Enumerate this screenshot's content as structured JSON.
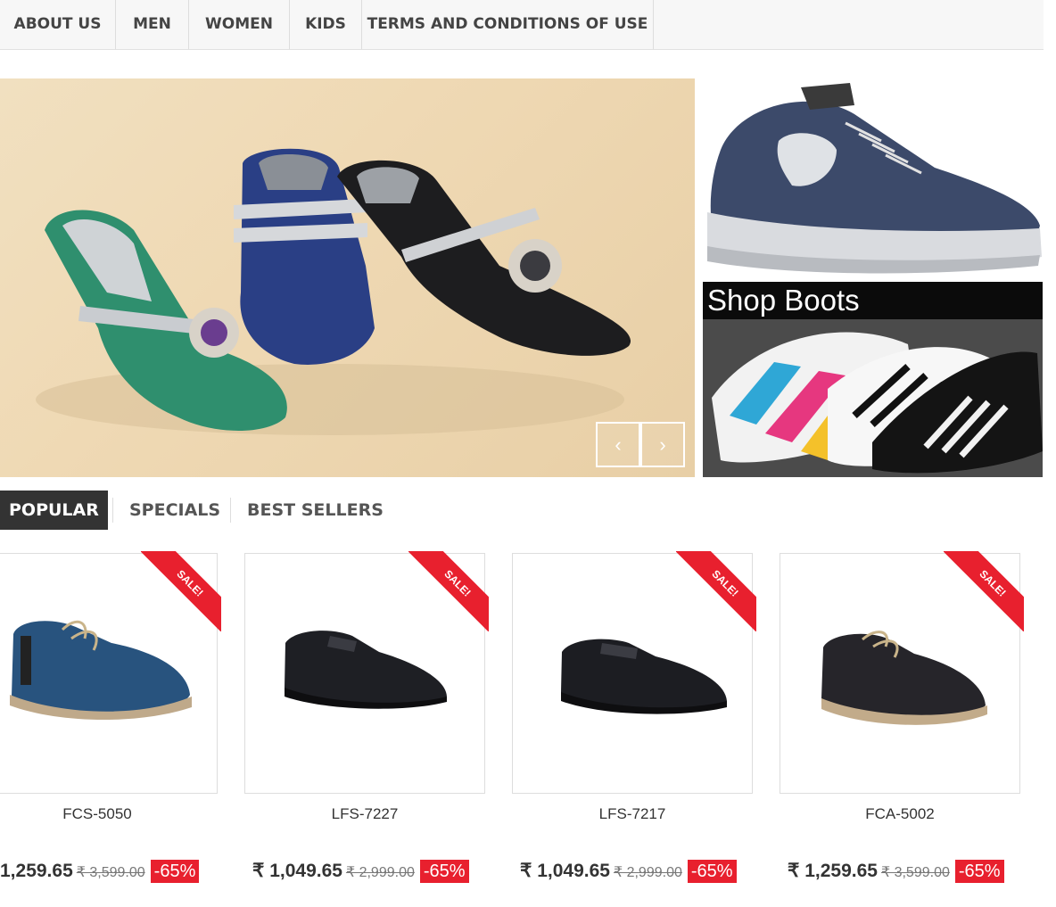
{
  "nav": {
    "items": [
      "ABOUT US",
      "MEN",
      "WOMEN",
      "KIDS",
      "TERMS AND CONDITIONS OF USE"
    ]
  },
  "slider": {
    "prev_icon": "chevron-left-icon",
    "next_icon": "chevron-right-icon",
    "prev_glyph": "‹",
    "next_glyph": "›"
  },
  "banners": {
    "boots_title": "Shop Boots"
  },
  "tabs": [
    "POPULAR",
    "SPECIALS",
    "BEST SELLERS"
  ],
  "products": [
    {
      "name": "FCS-5050",
      "price": "1,259.65",
      "old_price": "₹ 3,599.00",
      "discount": "-65%",
      "ribbon": "SALE!"
    },
    {
      "name": "LFS-7227",
      "price": "₹ 1,049.65",
      "old_price": "₹ 2,999.00",
      "discount": "-65%",
      "ribbon": "SALE!"
    },
    {
      "name": "LFS-7217",
      "price": "₹ 1,049.65",
      "old_price": "₹ 2,999.00",
      "discount": "-65%",
      "ribbon": "SALE!"
    },
    {
      "name": "FCA-5002",
      "price": "₹ 1,259.65",
      "old_price": "₹ 3,599.00",
      "discount": "-65%",
      "ribbon": "SALE!"
    }
  ],
  "colors": {
    "accent_red": "#e8202e",
    "tab_active_bg": "#333333",
    "nav_bg": "#f7f7f7"
  }
}
